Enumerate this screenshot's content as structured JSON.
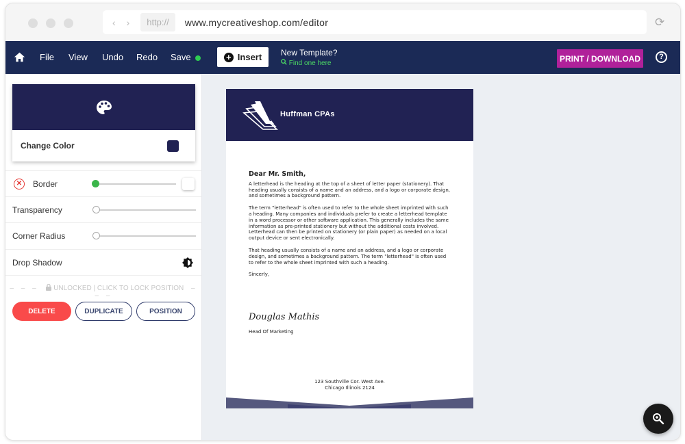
{
  "browser": {
    "nav_arrows": "‹ ›",
    "protocol": "http://",
    "url": "www.mycreativeshop.com/editor",
    "reload_icon": "⟳"
  },
  "toolbar": {
    "menu": [
      "File",
      "View",
      "Undo",
      "Redo",
      "Save"
    ],
    "save_status_color": "#2ecc52",
    "insert_label": "Insert",
    "new_template_title": "New Template?",
    "new_template_link": "Find one here",
    "print_label": "PRINT / DOWNLOAD",
    "help_icon": "?"
  },
  "sidebar": {
    "change_color_label": "Change Color",
    "selected_color": "#212253",
    "properties": {
      "border": {
        "label": "Border",
        "value": 0
      },
      "transparency": {
        "label": "Transparency",
        "value": 0
      },
      "corner_radius": {
        "label": "Corner Radius",
        "value": 0
      },
      "drop_shadow": {
        "label": "Drop Shadow"
      }
    },
    "lock_text": "UNLOCKED | CLICK TO LOCK POSITION",
    "buttons": {
      "delete": "DELETE",
      "duplicate": "DUPLICATE",
      "position": "POSITION"
    }
  },
  "document": {
    "brand_name": "Huffman CPAs",
    "greeting": "Dear Mr. Smith,",
    "paragraphs": [
      "A letterhead is the heading at the top of a sheet of letter paper (stationery). That heading usually consists of a name and an address, and a logo or corporate design, and sometimes a background pattern.",
      "The term \"letterhead\" is often used to refer to the whole sheet imprinted with such a heading. Many companies and individuals prefer to create a letterhead template in a word processor or other software application. This generally includes the same information as pre-printed stationery but without the additional costs involved. Letterhead can then be printed on stationery  (or plain paper) as needed on a local output device or sent electronically.",
      "That heading usually consists of a name and an address, and a logo or corporate design, and sometimes a background pattern. The term \"letterhead\" is often used to refer to the whole sheet imprinted with such a heading."
    ],
    "closing": "Sincerly,",
    "signature": "Douglas Mathis",
    "signer_title": "Head Of Marketing",
    "address_line1": "123 Southville Cor. West Ave.",
    "address_line2": "Chicago Illinois 2124"
  }
}
